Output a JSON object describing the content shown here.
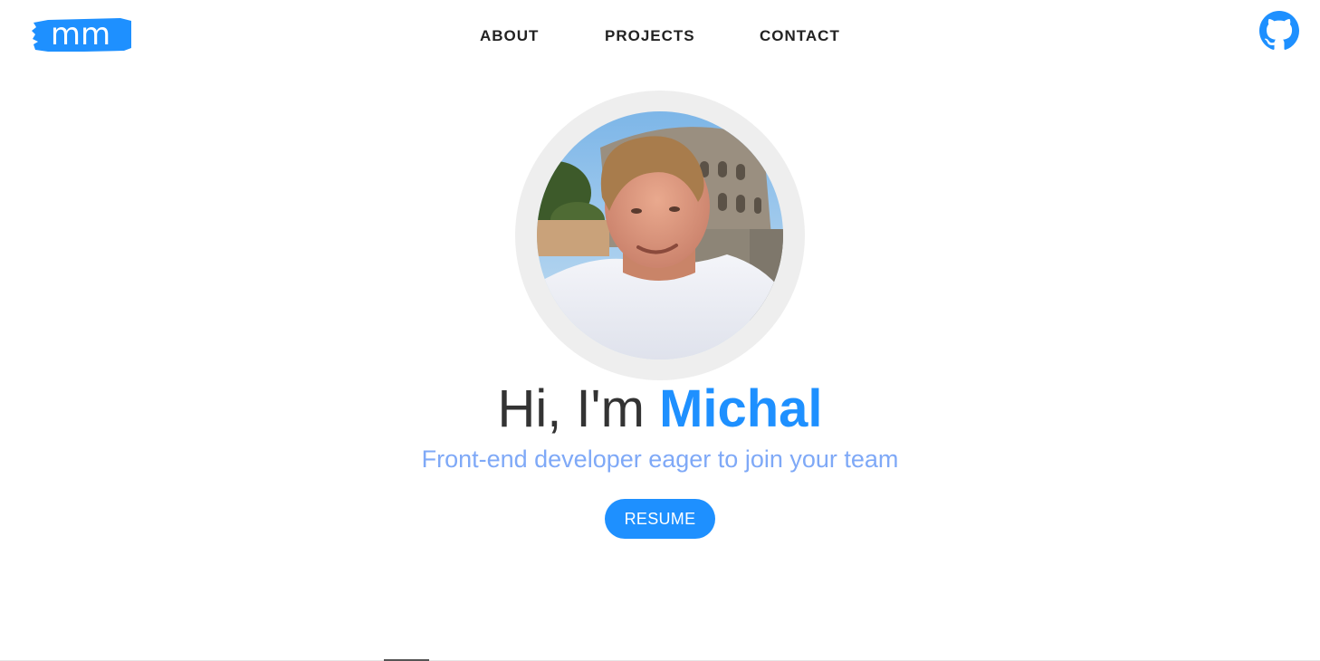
{
  "header": {
    "logo_text": "mm",
    "nav": [
      {
        "label": "ABOUT"
      },
      {
        "label": "PROJECTS"
      },
      {
        "label": "CONTACT"
      }
    ],
    "github_icon": "github-icon"
  },
  "hero": {
    "greeting": "Hi, I'm ",
    "name": "Michal",
    "subtitle": "Front-end developer eager to join your team",
    "resume_label": "RESUME"
  },
  "colors": {
    "accent": "#1e90ff",
    "subtitle": "#7fa9f7",
    "text": "#333333",
    "nav_text": "#222222",
    "avatar_ring": "#eeeeee"
  }
}
